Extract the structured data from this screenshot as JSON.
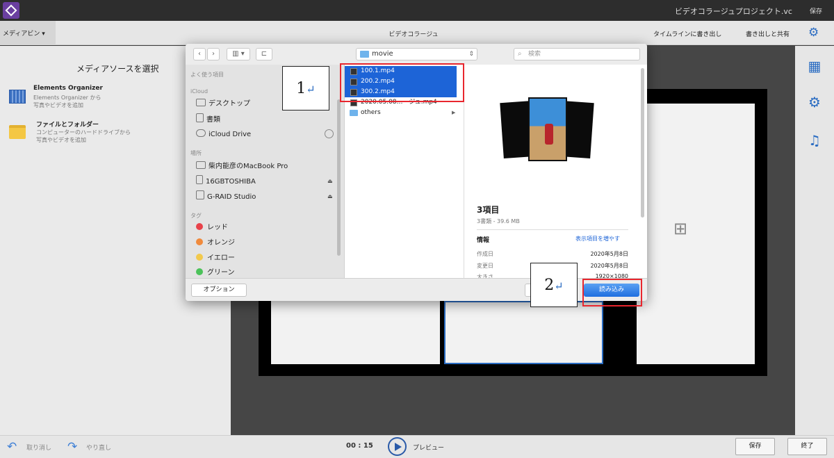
{
  "titlebar": {
    "project_title": "ビデオコラージュプロジェクト.vc",
    "save": "保存"
  },
  "menubar": {
    "media_bin": "メディアビン ▾",
    "collage_title": "ビデオコラージュ",
    "export_timeline": "タイムラインに書き出し",
    "export_share": "書き出しと共有"
  },
  "left_panel": {
    "heading": "メディアソースを選択",
    "sources": [
      {
        "title": "Elements Organizer",
        "sub1": "Elements Organizer から",
        "sub2": "写真やビデオを追加"
      },
      {
        "title": "ファイルとフォルダー",
        "sub1": "コンピューターのハードドライブから",
        "sub2": "写真やビデオを追加"
      }
    ]
  },
  "dialog": {
    "path": "movie",
    "search_placeholder": "検索",
    "sidebar": {
      "favorites_head": "よく使う項目",
      "icloud_head": "iCloud",
      "icloud_items": [
        "デスクトップ",
        "書類",
        "iCloud Drive"
      ],
      "locations_head": "場所",
      "locations": [
        "柴内能彦のMacBook Pro",
        "16GBTOSHIBA",
        "G-RAID Studio"
      ],
      "tags_head": "タグ",
      "tags": [
        {
          "label": "レッド",
          "color": "#e8424a"
        },
        {
          "label": "オレンジ",
          "color": "#f08a3c"
        },
        {
          "label": "イエロー",
          "color": "#f2c94c"
        },
        {
          "label": "グリーン",
          "color": "#4cc25a"
        }
      ]
    },
    "files": [
      "100.1.mp4",
      "200.2.mp4",
      "300.2.mp4",
      "2020.05.08…ージュ.mp4",
      "others"
    ],
    "preview": {
      "title": "3項目",
      "subtitle": "3書類 - 39.6 MB",
      "info_label": "情報",
      "show_more": "表示項目を増やす",
      "rows": [
        {
          "key": "作成日",
          "value": "2020年5月8日"
        },
        {
          "key": "変更日",
          "value": "2020年5月8日"
        },
        {
          "key": "大きさ",
          "value": "1920×1080"
        }
      ]
    },
    "options_label": "オプション",
    "import_label": "読み込み"
  },
  "annotations": {
    "callout_1": "1",
    "callout_2": "2",
    "arrow": "↵"
  },
  "bottombar": {
    "undo": "取り消し",
    "redo": "やり直し",
    "time": "00 : 15",
    "preview": "プレビュー",
    "save": "保存",
    "end": "終了"
  },
  "colors": {
    "accent": "#1d64d7",
    "annotation_red": "#e8262e",
    "canvas_bg": "#464646"
  }
}
